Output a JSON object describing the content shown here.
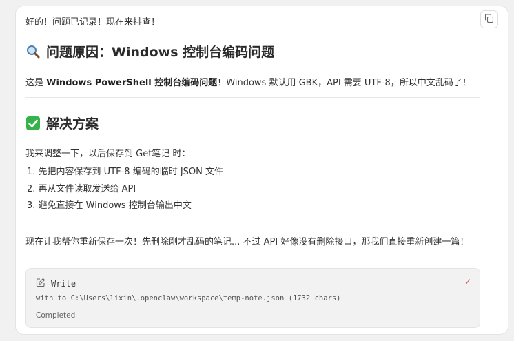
{
  "message": {
    "intro": "好的！问题已记录！现在来排查！",
    "section1": {
      "emoji": "search-icon",
      "title": "问题原因：Windows 控制台编码问题",
      "para_prefix": "这是 ",
      "para_bold": "Windows PowerShell 控制台编码问题",
      "para_suffix": "！Windows 默认用 GBK，API 需要 UTF-8，所以中文乱码了！"
    },
    "section2": {
      "emoji": "check-mark-icon",
      "title": "解决方案",
      "intro": "我来调整一下，以后保存到 Get笔记 时：",
      "steps": [
        "1. 先把内容保存到 UTF-8 编码的临时 JSON 文件",
        "2. 再从文件读取发送给 API",
        "3. 避免直接在 Windows 控制台输出中文"
      ]
    },
    "closing": "现在让我帮你重新保存一次！先删除刚才乱码的笔记... 不过 API 好像没有删除接口，那我们直接重新创建一篇！"
  },
  "tool_call": {
    "icon": "edit-icon",
    "name": "Write",
    "detail": "with to C:\\Users\\lixin\\.openclaw\\workspace\\temp-note.json (1732 chars)",
    "status": "Completed",
    "status_mark": "✓"
  },
  "colors": {
    "background": "#f1f1f1",
    "card": "#ffffff",
    "tool_bg": "#f2f2f2",
    "success_mark": "#d9534f",
    "check_emoji_green": "#35b24a"
  }
}
